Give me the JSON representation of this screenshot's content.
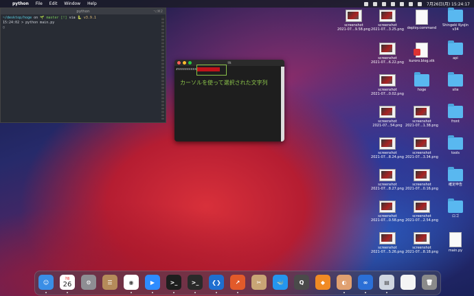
{
  "menubar": {
    "app_name": "python",
    "items": [
      "File",
      "Edit",
      "Window",
      "Help"
    ],
    "clock": "7月26日(月)  15:24:17"
  },
  "terminal": {
    "title": "python",
    "shortcut": "⌥⌘2",
    "line1_path": "~/desktop/hoge",
    "line1_on": " on ",
    "line1_branch": "🌱 master [!] ",
    "line1_via": "via ",
    "line1_version": "🐍 v3.9.1",
    "line2": "15:24:02 > python main.py",
    "line3": "▯"
  },
  "tk": {
    "title": "tk",
    "input_value": "zsssssssss",
    "caption": "カーソルを使って選択された文字列"
  },
  "desktop_icons": [
    {
      "label": "screenshot\n2021-07...9.58.png",
      "kind": "thumb"
    },
    {
      "label": "screenshot\n2021-07...3.25.png",
      "kind": "thumb"
    },
    {
      "label": "deploy.command",
      "kind": "doc"
    },
    {
      "label": "Shingeki Kyojin\nv34",
      "kind": "folder"
    },
    {
      "label": "screenshot\n2021-07...6.22.png",
      "kind": "thumb"
    },
    {
      "label": "kuroro.blog.stk",
      "kind": "docred"
    },
    {
      "label": "api",
      "kind": "folder"
    },
    {
      "label": "screenshot\n2021-07...0.02.png",
      "kind": "thumb"
    },
    {
      "label": "hoge",
      "kind": "folder"
    },
    {
      "label": "site",
      "kind": "folder"
    },
    {
      "label": "screenshot\n2021-07...54.png",
      "kind": "thumb"
    },
    {
      "label": "screenshot\n2021-07...1.38.png",
      "kind": "thumb"
    },
    {
      "label": "front",
      "kind": "folder"
    },
    {
      "label": "screenshot\n2021-07...8.24.png",
      "kind": "thumb"
    },
    {
      "label": "screenshot\n2021-07...3.34.png",
      "kind": "thumb"
    },
    {
      "label": "tools",
      "kind": "folder"
    },
    {
      "label": "screenshot\n2021-07...8.27.png",
      "kind": "thumb"
    },
    {
      "label": "screenshot\n2021-07...0.16.png",
      "kind": "thumb"
    },
    {
      "label": "確定申告",
      "kind": "folder"
    },
    {
      "label": "screenshot\n2021-07...0.58.png",
      "kind": "thumb"
    },
    {
      "label": "screenshot\n2021-07...2.54.png",
      "kind": "thumb"
    },
    {
      "label": "ロゴ",
      "kind": "folder"
    },
    {
      "label": "screenshot\n2021-07...5.26.png",
      "kind": "thumb"
    },
    {
      "label": "screenshot\n2021-07...8.18.png",
      "kind": "thumb"
    },
    {
      "label": "main.py",
      "kind": "doc"
    }
  ],
  "dock": {
    "calendar_month": "7月",
    "calendar_day": "26",
    "apps": [
      {
        "name": "finder-icon",
        "color": "#3a8ee6",
        "glyph": "☺"
      },
      {
        "name": "calendar-icon",
        "color": "#ffffff",
        "glyph": ""
      },
      {
        "name": "system-preferences-icon",
        "color": "#8e8e93",
        "glyph": "⚙"
      },
      {
        "name": "contacts-icon",
        "color": "#b58b5a",
        "glyph": "☰"
      },
      {
        "name": "chrome-icon",
        "color": "#ffffff",
        "glyph": "◉"
      },
      {
        "name": "zoom-icon",
        "color": "#2d8cff",
        "glyph": "▶"
      },
      {
        "name": "terminal-green-icon",
        "color": "#1e1e1e",
        "glyph": ">_"
      },
      {
        "name": "terminal-icon",
        "color": "#2a2a2a",
        "glyph": ">_"
      },
      {
        "name": "vscode-icon",
        "color": "#1f6fd0",
        "glyph": "❮❯"
      },
      {
        "name": "activity-icon",
        "color": "#e25a2a",
        "glyph": "↗"
      },
      {
        "name": "sketch-icon",
        "color": "#c8a575",
        "glyph": "✂"
      },
      {
        "name": "docker-icon",
        "color": "#2496ed",
        "glyph": "🐳"
      },
      {
        "name": "quicktime-icon",
        "color": "#4a4a4a",
        "glyph": "Q"
      },
      {
        "name": "git-icon",
        "color": "#f08a24",
        "glyph": "◆"
      },
      {
        "name": "preview-icon",
        "color": "#e0a070",
        "glyph": "◐"
      },
      {
        "name": "infinity-icon",
        "color": "#2b6fd6",
        "glyph": "∞"
      },
      {
        "name": "screenshot-app-icon",
        "color": "#cfd6e0",
        "glyph": "▤"
      },
      {
        "name": "document-icon",
        "color": "#f4f4f4",
        "glyph": ""
      },
      {
        "name": "trash-icon",
        "color": "#8a8a8a",
        "glyph": "🗑"
      }
    ]
  }
}
